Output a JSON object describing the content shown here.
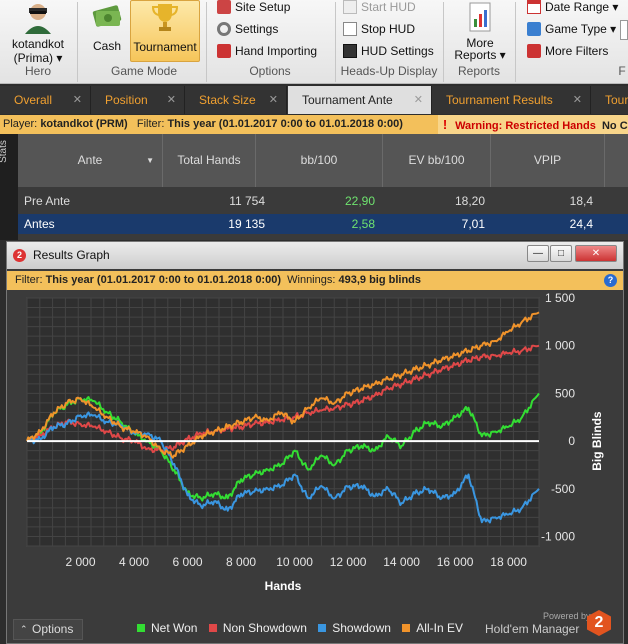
{
  "ribbon": {
    "hero": {
      "name": "kotandkot",
      "site": "(Prima) ▾",
      "group_label": "Hero"
    },
    "game_mode": {
      "cash_label": "Cash",
      "tournament_label": "Tournament",
      "group_label": "Game Mode"
    },
    "options": {
      "site_setup": "Site Setup",
      "settings": "Settings",
      "hand_importing": "Hand Importing",
      "group_label": "Options"
    },
    "hud": {
      "start_hud": "Start HUD",
      "stop_hud": "Stop HUD",
      "hud_settings": "HUD Settings",
      "group_label": "Heads-Up Display"
    },
    "reports": {
      "more_reports_line1": "More",
      "more_reports_line2": "Reports ▾",
      "group_label": "Reports"
    },
    "filters": {
      "date_range": "Date Range ▾",
      "game_type": "Game Type ▾",
      "more_filters": "More Filters",
      "group_label": "F"
    }
  },
  "tabs": [
    {
      "label": "Overall"
    },
    {
      "label": "Position"
    },
    {
      "label": "Stack Size"
    },
    {
      "label": "Tournament Ante"
    },
    {
      "label": "Tournament Results"
    },
    {
      "label": "Tour"
    }
  ],
  "tab_close": "✕",
  "infobar": {
    "player_label": "Player:",
    "player_value": "kotandkot (PRM)",
    "filter_label": "Filter:",
    "filter_value": "This year (01.01.2017 0:00 to 01.01.2018 0:00)",
    "warning_icon": "!",
    "warning_text": "Warning: Restricted Hands",
    "no_text": "No C"
  },
  "stats": {
    "side_label": "Stats",
    "headers": [
      "Ante",
      "Total Hands",
      "bb/100",
      "EV bb/100",
      "VPIP"
    ],
    "sort_arrow": "▼",
    "rows": [
      {
        "name": "Pre Ante",
        "total": "11 754",
        "bb100": "22,90",
        "ev": "18,20",
        "vpip": "18,4"
      },
      {
        "name": "Antes",
        "total": "19 135",
        "bb100": "2,58",
        "ev": "7,01",
        "vpip": "24,4"
      }
    ]
  },
  "window": {
    "title": "Results Graph",
    "app_icon": "2",
    "filter_label": "Filter:",
    "filter_value": "This year (01.01.2017 0:00 to 01.01.2018 0:00)",
    "winnings_label": "Winnings:",
    "winnings_value": "493,9 big blinds",
    "help": "?",
    "options_label": "Options",
    "powered_by": "Powered by",
    "brand": "Hold'em Manager",
    "brand_num": "2"
  },
  "colors": {
    "net_won": "#33dd33",
    "non_showdown": "#e04848",
    "showdown": "#3a96e0",
    "all_in_ev": "#f0932b",
    "accent": "#f0a030"
  },
  "chart_data": {
    "type": "line",
    "xlabel": "Hands",
    "ylabel": "Big Blinds",
    "xlim": [
      0,
      19135
    ],
    "ylim": [
      -1100,
      1500
    ],
    "x_ticks": [
      2000,
      4000,
      6000,
      8000,
      10000,
      12000,
      14000,
      16000,
      18000
    ],
    "x_tick_labels": [
      "2 000",
      "4 000",
      "6 000",
      "8 000",
      "10 000",
      "12 000",
      "14 000",
      "16 000",
      "18 000"
    ],
    "y_ticks": [
      1500,
      1000,
      500,
      0,
      -500,
      -1000
    ],
    "y_tick_labels": [
      "1 500",
      "1 000",
      "500",
      "0",
      "-500",
      "-1 000"
    ],
    "grid": true,
    "legend": "bottom",
    "series": [
      {
        "name": "Net Won",
        "color": "#33dd33",
        "x": [
          0,
          500,
          1000,
          1500,
          2000,
          2500,
          3000,
          3500,
          4000,
          4500,
          5000,
          5500,
          6000,
          6500,
          7000,
          7500,
          8000,
          8500,
          9000,
          9500,
          10000,
          10500,
          11000,
          11500,
          12000,
          12500,
          13000,
          13500,
          14000,
          14500,
          15000,
          15500,
          16000,
          16500,
          17000,
          17500,
          18000,
          18500,
          19135
        ],
        "y": [
          0,
          80,
          300,
          380,
          450,
          420,
          300,
          200,
          80,
          0,
          -100,
          -300,
          -550,
          -600,
          -550,
          -600,
          -400,
          -350,
          -300,
          -250,
          -100,
          -300,
          -150,
          -250,
          -100,
          -50,
          -100,
          50,
          -50,
          100,
          200,
          150,
          250,
          350,
          50,
          100,
          150,
          250,
          500
        ]
      },
      {
        "name": "Non Showdown",
        "color": "#e04848",
        "x": [
          0,
          500,
          1000,
          1500,
          2000,
          2500,
          3000,
          3500,
          4000,
          4500,
          5000,
          5500,
          6000,
          6500,
          7000,
          7500,
          8000,
          8500,
          9000,
          9500,
          10000,
          10500,
          11000,
          11500,
          12000,
          12500,
          13000,
          13500,
          14000,
          14500,
          15000,
          15500,
          16000,
          16500,
          17000,
          17500,
          18000,
          18500,
          19135
        ],
        "y": [
          0,
          60,
          150,
          200,
          180,
          150,
          100,
          30,
          0,
          -80,
          -100,
          -60,
          20,
          80,
          100,
          130,
          150,
          180,
          200,
          220,
          250,
          300,
          320,
          350,
          380,
          420,
          480,
          550,
          600,
          650,
          700,
          750,
          800,
          850,
          880,
          900,
          920,
          950,
          1000
        ]
      },
      {
        "name": "Showdown",
        "color": "#3a96e0",
        "x": [
          0,
          500,
          1000,
          1500,
          2000,
          2500,
          3000,
          3500,
          4000,
          4500,
          5000,
          5500,
          6000,
          6500,
          7000,
          7500,
          8000,
          8500,
          9000,
          9500,
          10000,
          10500,
          11000,
          11500,
          12000,
          12500,
          13000,
          13500,
          14000,
          14500,
          15000,
          15500,
          16000,
          16500,
          17000,
          17500,
          18000,
          18500,
          19135
        ],
        "y": [
          0,
          20,
          150,
          180,
          270,
          270,
          200,
          170,
          80,
          80,
          0,
          -240,
          -570,
          -680,
          -630,
          -730,
          -550,
          -530,
          -500,
          -470,
          -350,
          -600,
          -470,
          -600,
          -480,
          -470,
          -580,
          -500,
          -650,
          -550,
          -500,
          -600,
          -550,
          -350,
          -850,
          -800,
          -770,
          -700,
          -500
        ]
      },
      {
        "name": "All-In EV",
        "color": "#f0932b",
        "x": [
          0,
          500,
          1000,
          1500,
          2000,
          2500,
          3000,
          3500,
          4000,
          4500,
          5000,
          5500,
          6000,
          6500,
          7000,
          7500,
          8000,
          8500,
          9000,
          9500,
          10000,
          10500,
          11000,
          11500,
          12000,
          12500,
          13000,
          13500,
          14000,
          14500,
          15000,
          15500,
          16000,
          16500,
          17000,
          17500,
          18000,
          18500,
          19135
        ],
        "y": [
          0,
          100,
          300,
          400,
          450,
          350,
          250,
          150,
          100,
          50,
          -100,
          -150,
          -50,
          50,
          100,
          150,
          200,
          250,
          220,
          300,
          200,
          350,
          450,
          400,
          500,
          550,
          600,
          650,
          700,
          750,
          800,
          850,
          900,
          950,
          1000,
          1050,
          1150,
          1250,
          1350
        ]
      }
    ]
  }
}
